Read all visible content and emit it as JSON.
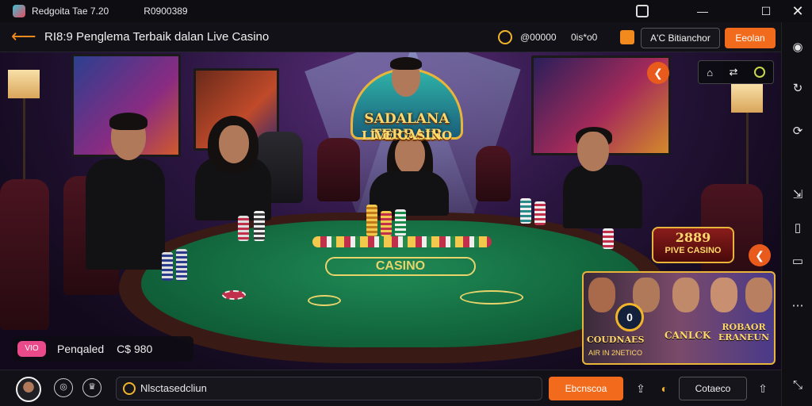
{
  "window": {
    "title": "Redgoita Tae 7.20",
    "subtitle": "R0900389",
    "controls": [
      "minimize",
      "maximize",
      "close"
    ]
  },
  "header": {
    "title": "RI8:9 Penglema Terbaik dalan Live Casino",
    "balance": "@00000",
    "status": "0is*o0",
    "outline_button": "A'C Bitianchor",
    "primary_button": "Eeolan"
  },
  "stage": {
    "logo_line1": "SADALANA TERBAIR",
    "logo_line2": "LIVE CASINO",
    "felt_label": "CASINO",
    "tools": [
      "home-icon",
      "share-icon",
      "record-icon"
    ],
    "promo_badge": {
      "number": "2889",
      "text": "PIVE CASINO"
    },
    "promo_card": {
      "number": "0",
      "title_left": "COUDNAES",
      "title_mid": "CANLCK",
      "title_right": "ROBAOR ERANEUN",
      "footer": "AIR IN 2NETICO"
    },
    "notification": {
      "tag": "VIO",
      "label": "Penqaled",
      "value": "C$ 980"
    }
  },
  "bottom_bar": {
    "chat_text": "Nlsctasedcliun",
    "primary_button": "Ebcnscoa",
    "outline_button": "Cotaeco"
  },
  "right_rail": [
    "camera-icon",
    "refresh-icon",
    "sync-icon",
    "share-icon",
    "phone-icon",
    "window-icon",
    "more-icon",
    "close-expand-icon"
  ],
  "colors": {
    "accent": "#f26a1b",
    "gold": "#e9b43a",
    "felt": "#1f8a55",
    "background": "#0b0a10"
  }
}
